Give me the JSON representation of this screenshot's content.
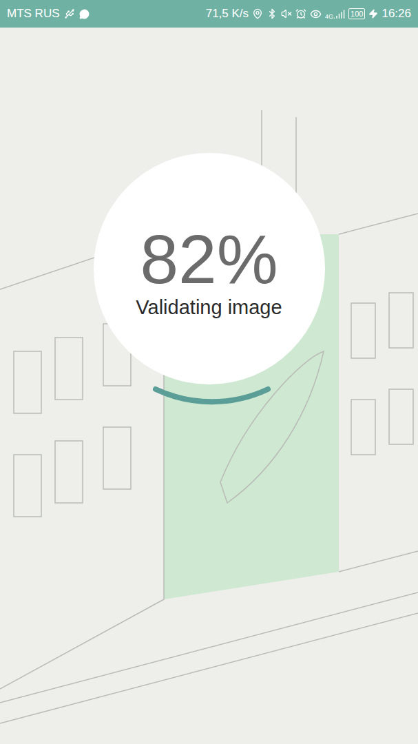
{
  "status_bar": {
    "carrier": "MTS RUS",
    "speed": "71,5 K/s",
    "network": "4G",
    "battery": "100",
    "time": "16:26"
  },
  "progress": {
    "percent": "82%",
    "label": "Validating image"
  }
}
